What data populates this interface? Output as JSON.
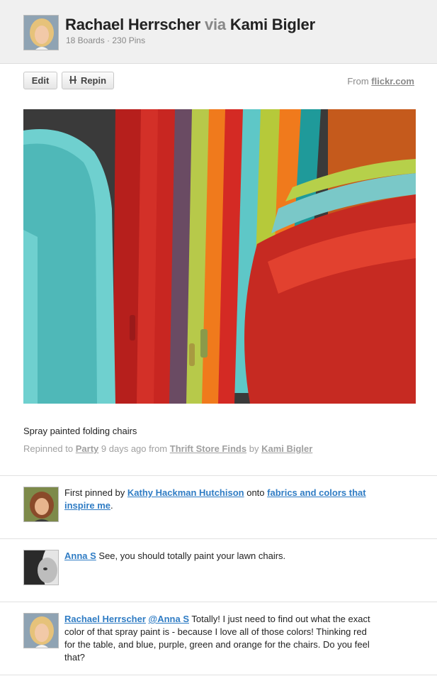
{
  "header": {
    "user": "Rachael Herrscher",
    "via": "via",
    "source_user": "Kami Bigler",
    "stats": "18 Boards · 230 Pins"
  },
  "actions": {
    "edit_label": "Edit",
    "repin_label": "Repin",
    "from_prefix": "From",
    "from_domain": "flickr.com"
  },
  "pin": {
    "caption": "Spray painted folding chairs",
    "repinned_prefix": "Repinned to",
    "board": "Party",
    "time_from": "9 days ago from",
    "source_board": "Thrift Store Finds",
    "by": "by",
    "source_user": "Kami Bigler"
  },
  "first_pin": {
    "prefix": "First pinned by",
    "user": "Kathy Hackman Hutchison",
    "onto": "onto",
    "board": "fabrics and colors that inspire me",
    "suffix": "."
  },
  "comments": [
    {
      "author": "Anna S",
      "text": " See, you should totally paint your lawn chairs."
    },
    {
      "author": "Rachael Herrscher",
      "mention": "@Anna S",
      "text": " Totally! I just need to find out what the exact color of that spray paint is - because I love all of those colors! Thinking red for the table, and blue, purple, green and orange for the chairs. Do you feel that?"
    }
  ],
  "colors": {
    "link": "#2f7cc4",
    "muted": "#a0a0a0",
    "header_bg": "#f0f0f0"
  }
}
